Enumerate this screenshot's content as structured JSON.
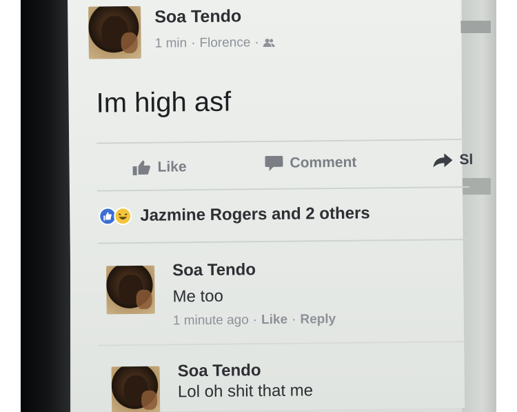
{
  "post": {
    "author": "Soa Tendo",
    "time": "1 min",
    "location": "Florence",
    "separator": "·",
    "privacy_icon": "friends-icon",
    "text": "Im high asf"
  },
  "actions": {
    "like": "Like",
    "comment": "Comment",
    "share": "Sl"
  },
  "reactions": {
    "icons": [
      "like-reaction-icon",
      "haha-reaction-icon"
    ],
    "summary": "Jazmine Rogers and 2 others"
  },
  "comments": [
    {
      "author": "Soa Tendo",
      "text": "Me too",
      "time": "1 minute ago",
      "like": "Like",
      "reply": "Reply"
    },
    {
      "author": "Soa Tendo",
      "text": "Lol oh shit that me"
    }
  ],
  "colors": {
    "accent_blue": "#3b6fd6",
    "text_dark": "#1c1e21",
    "meta_gray": "#8d9197"
  }
}
